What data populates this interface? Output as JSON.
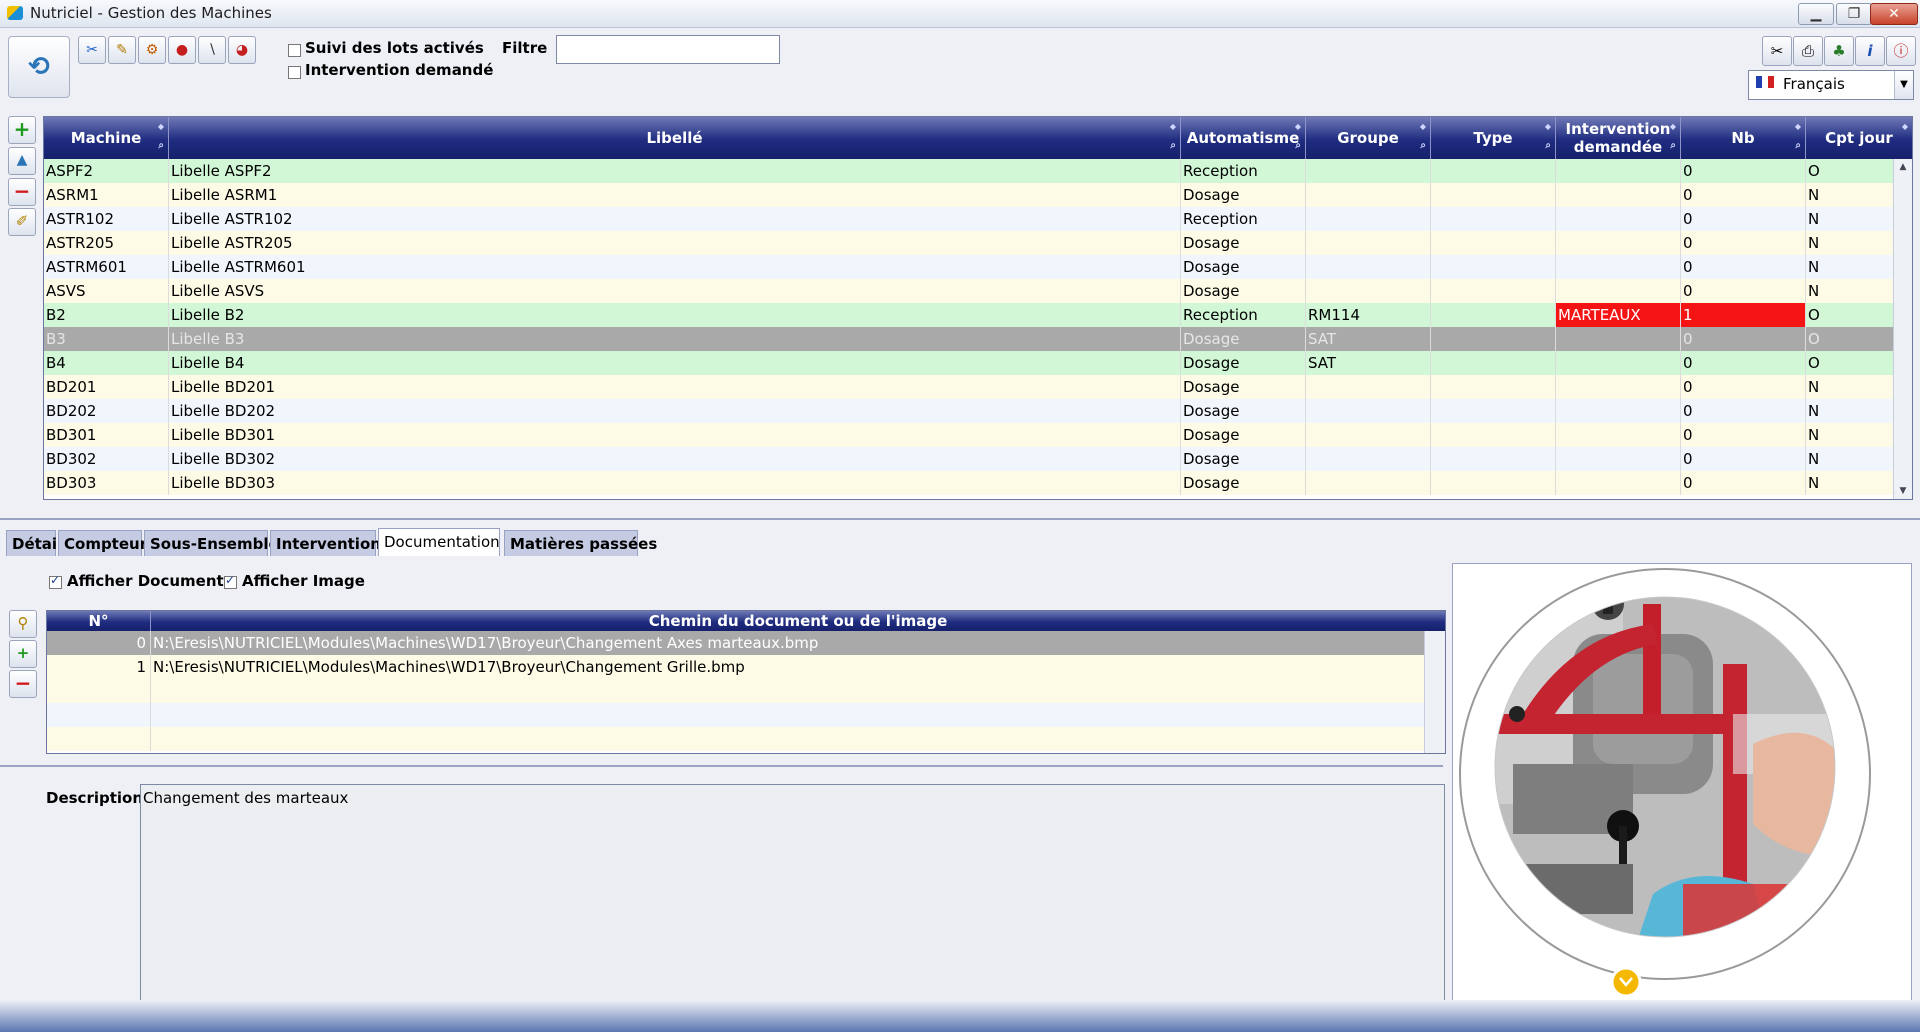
{
  "window": {
    "title": "Nutriciel - Gestion des Machines"
  },
  "toolbar": {
    "chk_suivi": "Suivi des lots activés",
    "chk_intervention": "Intervention demandé",
    "filtre_label": "Filtre",
    "filtre_value": "",
    "language": "Français"
  },
  "table": {
    "headers": [
      "Machine",
      "Libellé",
      "Automatisme",
      "Groupe",
      "Type",
      "Intervention demandée",
      "Nb",
      "Cpt jour"
    ],
    "rows": [
      {
        "machine": "ASPF2",
        "libelle": "Libelle ASPF2",
        "auto": "Reception",
        "groupe": "",
        "type": "",
        "interv": "",
        "nb": "0",
        "cpt": "O",
        "style": "green"
      },
      {
        "machine": "ASRM1",
        "libelle": "Libelle ASRM1",
        "auto": "Dosage",
        "groupe": "",
        "type": "",
        "interv": "",
        "nb": "0",
        "cpt": "N",
        "style": "cream"
      },
      {
        "machine": "ASTR102",
        "libelle": "Libelle ASTR102",
        "auto": "Reception",
        "groupe": "",
        "type": "",
        "interv": "",
        "nb": "0",
        "cpt": "N",
        "style": "light"
      },
      {
        "machine": "ASTR205",
        "libelle": "Libelle ASTR205",
        "auto": "Dosage",
        "groupe": "",
        "type": "",
        "interv": "",
        "nb": "0",
        "cpt": "N",
        "style": "cream"
      },
      {
        "machine": "ASTRM601",
        "libelle": "Libelle ASTRM601",
        "auto": "Dosage",
        "groupe": "",
        "type": "",
        "interv": "",
        "nb": "0",
        "cpt": "N",
        "style": "light"
      },
      {
        "machine": "ASVS",
        "libelle": "Libelle ASVS",
        "auto": "Dosage",
        "groupe": "",
        "type": "",
        "interv": "",
        "nb": "0",
        "cpt": "N",
        "style": "cream"
      },
      {
        "machine": "B2",
        "libelle": "Libelle B2",
        "auto": "Reception",
        "groupe": "RM114",
        "type": "",
        "interv": "MARTEAUX",
        "nb": "1",
        "cpt": "O",
        "style": "green",
        "alert": true
      },
      {
        "machine": "B3",
        "libelle": "Libelle B3",
        "auto": "Dosage",
        "groupe": "SAT",
        "type": "",
        "interv": "",
        "nb": "0",
        "cpt": "O",
        "style": "sel"
      },
      {
        "machine": "B4",
        "libelle": "Libelle B4",
        "auto": "Dosage",
        "groupe": "SAT",
        "type": "",
        "interv": "",
        "nb": "0",
        "cpt": "O",
        "style": "green"
      },
      {
        "machine": "BD201",
        "libelle": "Libelle BD201",
        "auto": "Dosage",
        "groupe": "",
        "type": "",
        "interv": "",
        "nb": "0",
        "cpt": "N",
        "style": "cream"
      },
      {
        "machine": "BD202",
        "libelle": "Libelle BD202",
        "auto": "Dosage",
        "groupe": "",
        "type": "",
        "interv": "",
        "nb": "0",
        "cpt": "N",
        "style": "light"
      },
      {
        "machine": "BD301",
        "libelle": "Libelle BD301",
        "auto": "Dosage",
        "groupe": "",
        "type": "",
        "interv": "",
        "nb": "0",
        "cpt": "N",
        "style": "cream"
      },
      {
        "machine": "BD302",
        "libelle": "Libelle BD302",
        "auto": "Dosage",
        "groupe": "",
        "type": "",
        "interv": "",
        "nb": "0",
        "cpt": "N",
        "style": "light"
      },
      {
        "machine": "BD303",
        "libelle": "Libelle BD303",
        "auto": "Dosage",
        "groupe": "",
        "type": "",
        "interv": "",
        "nb": "0",
        "cpt": "N",
        "style": "cream"
      }
    ]
  },
  "tabs": [
    "Détail",
    "Compteur",
    "Sous-Ensembles",
    "Interventions",
    "Documentation",
    "Matières passées"
  ],
  "active_tab": "Documentation",
  "doc": {
    "chk_document": "Afficher Document",
    "chk_image": "Afficher Image",
    "col_num": "N°",
    "col_path": "Chemin du document ou de l'image",
    "rows": [
      {
        "n": "0",
        "path": "N:\\Eresis\\NUTRICIEL\\Modules\\Machines\\WD17\\Broyeur\\Changement Axes marteaux.bmp",
        "selected": true
      },
      {
        "n": "1",
        "path": "N:\\Eresis\\NUTRICIEL\\Modules\\Machines\\WD17\\Broyeur\\Changement Grille.bmp",
        "selected": false
      }
    ],
    "description_label": "Description",
    "description_value": "Changement des marteaux"
  },
  "colors": {
    "header_dark": "#1f2c80",
    "row_green": "#d2f7d6",
    "row_cream": "#fdfbe6",
    "alert": "#f41414"
  }
}
